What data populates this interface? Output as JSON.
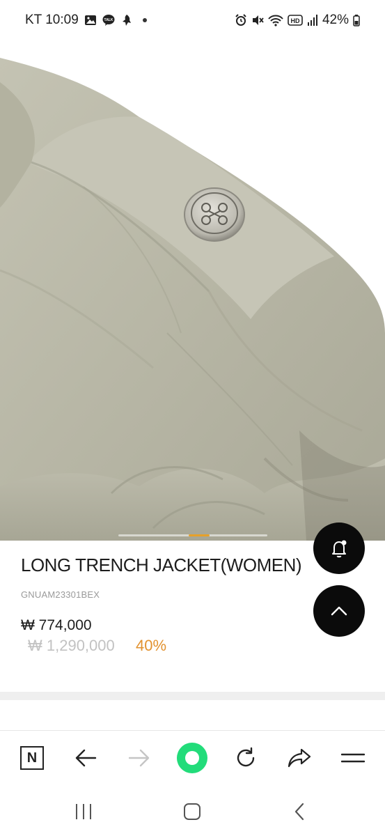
{
  "status_bar": {
    "carrier_time": "KT 10:09",
    "battery": "42%",
    "hd_label": "HD"
  },
  "product": {
    "title": "LONG TRENCH JACKET(WOMEN)",
    "sku": "GNUAM23301BEX",
    "price": "₩ 774,000",
    "original_price": "₩ 1,290,000",
    "discount": "40%"
  },
  "carousel": {
    "position_fraction": 0.55
  },
  "colors": {
    "fabric": "#b9b8a7",
    "discount": "#e2922f",
    "accent_green": "#22dc7a",
    "fab": "#0b0b0b"
  },
  "toolbar": {
    "n_label": "N"
  },
  "icons": {
    "status_left": [
      "gallery-icon",
      "talk-icon",
      "app-icon"
    ],
    "status_right": [
      "alarm-icon",
      "mute-icon",
      "wifi-icon",
      "hd-icon",
      "signal-icon",
      "battery-icon"
    ],
    "fab": [
      "bell-add-icon",
      "chevron-up-icon"
    ],
    "toolbar": [
      "naver-n-icon",
      "back-arrow-icon",
      "forward-arrow-icon",
      "green-home-icon",
      "refresh-icon",
      "share-icon",
      "menu-icon"
    ],
    "sysnav": [
      "recents-icon",
      "home-icon",
      "back-icon"
    ]
  }
}
